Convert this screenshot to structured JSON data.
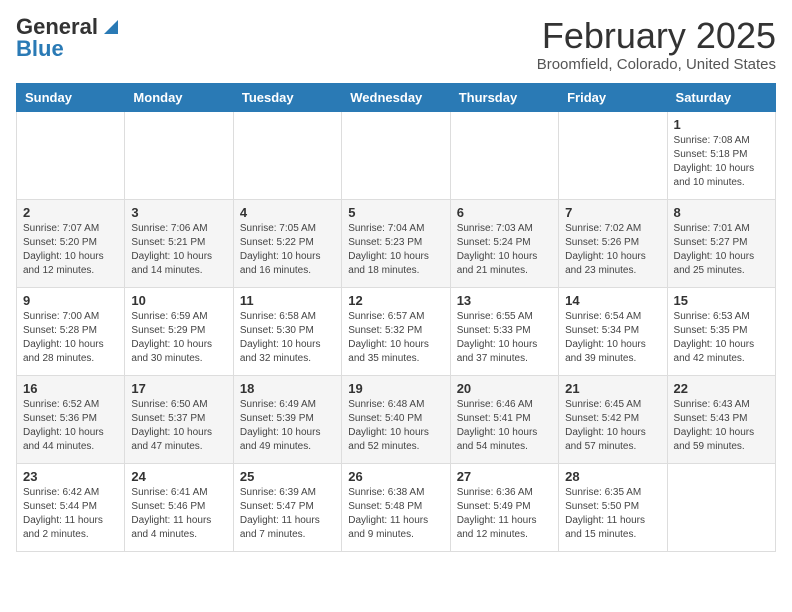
{
  "header": {
    "logo_general": "General",
    "logo_blue": "Blue",
    "main_title": "February 2025",
    "subtitle": "Broomfield, Colorado, United States"
  },
  "calendar": {
    "days_of_week": [
      "Sunday",
      "Monday",
      "Tuesday",
      "Wednesday",
      "Thursday",
      "Friday",
      "Saturday"
    ],
    "weeks": [
      [
        {
          "day": "",
          "info": ""
        },
        {
          "day": "",
          "info": ""
        },
        {
          "day": "",
          "info": ""
        },
        {
          "day": "",
          "info": ""
        },
        {
          "day": "",
          "info": ""
        },
        {
          "day": "",
          "info": ""
        },
        {
          "day": "1",
          "info": "Sunrise: 7:08 AM\nSunset: 5:18 PM\nDaylight: 10 hours\nand 10 minutes."
        }
      ],
      [
        {
          "day": "2",
          "info": "Sunrise: 7:07 AM\nSunset: 5:20 PM\nDaylight: 10 hours\nand 12 minutes."
        },
        {
          "day": "3",
          "info": "Sunrise: 7:06 AM\nSunset: 5:21 PM\nDaylight: 10 hours\nand 14 minutes."
        },
        {
          "day": "4",
          "info": "Sunrise: 7:05 AM\nSunset: 5:22 PM\nDaylight: 10 hours\nand 16 minutes."
        },
        {
          "day": "5",
          "info": "Sunrise: 7:04 AM\nSunset: 5:23 PM\nDaylight: 10 hours\nand 18 minutes."
        },
        {
          "day": "6",
          "info": "Sunrise: 7:03 AM\nSunset: 5:24 PM\nDaylight: 10 hours\nand 21 minutes."
        },
        {
          "day": "7",
          "info": "Sunrise: 7:02 AM\nSunset: 5:26 PM\nDaylight: 10 hours\nand 23 minutes."
        },
        {
          "day": "8",
          "info": "Sunrise: 7:01 AM\nSunset: 5:27 PM\nDaylight: 10 hours\nand 25 minutes."
        }
      ],
      [
        {
          "day": "9",
          "info": "Sunrise: 7:00 AM\nSunset: 5:28 PM\nDaylight: 10 hours\nand 28 minutes."
        },
        {
          "day": "10",
          "info": "Sunrise: 6:59 AM\nSunset: 5:29 PM\nDaylight: 10 hours\nand 30 minutes."
        },
        {
          "day": "11",
          "info": "Sunrise: 6:58 AM\nSunset: 5:30 PM\nDaylight: 10 hours\nand 32 minutes."
        },
        {
          "day": "12",
          "info": "Sunrise: 6:57 AM\nSunset: 5:32 PM\nDaylight: 10 hours\nand 35 minutes."
        },
        {
          "day": "13",
          "info": "Sunrise: 6:55 AM\nSunset: 5:33 PM\nDaylight: 10 hours\nand 37 minutes."
        },
        {
          "day": "14",
          "info": "Sunrise: 6:54 AM\nSunset: 5:34 PM\nDaylight: 10 hours\nand 39 minutes."
        },
        {
          "day": "15",
          "info": "Sunrise: 6:53 AM\nSunset: 5:35 PM\nDaylight: 10 hours\nand 42 minutes."
        }
      ],
      [
        {
          "day": "16",
          "info": "Sunrise: 6:52 AM\nSunset: 5:36 PM\nDaylight: 10 hours\nand 44 minutes."
        },
        {
          "day": "17",
          "info": "Sunrise: 6:50 AM\nSunset: 5:37 PM\nDaylight: 10 hours\nand 47 minutes."
        },
        {
          "day": "18",
          "info": "Sunrise: 6:49 AM\nSunset: 5:39 PM\nDaylight: 10 hours\nand 49 minutes."
        },
        {
          "day": "19",
          "info": "Sunrise: 6:48 AM\nSunset: 5:40 PM\nDaylight: 10 hours\nand 52 minutes."
        },
        {
          "day": "20",
          "info": "Sunrise: 6:46 AM\nSunset: 5:41 PM\nDaylight: 10 hours\nand 54 minutes."
        },
        {
          "day": "21",
          "info": "Sunrise: 6:45 AM\nSunset: 5:42 PM\nDaylight: 10 hours\nand 57 minutes."
        },
        {
          "day": "22",
          "info": "Sunrise: 6:43 AM\nSunset: 5:43 PM\nDaylight: 10 hours\nand 59 minutes."
        }
      ],
      [
        {
          "day": "23",
          "info": "Sunrise: 6:42 AM\nSunset: 5:44 PM\nDaylight: 11 hours\nand 2 minutes."
        },
        {
          "day": "24",
          "info": "Sunrise: 6:41 AM\nSunset: 5:46 PM\nDaylight: 11 hours\nand 4 minutes."
        },
        {
          "day": "25",
          "info": "Sunrise: 6:39 AM\nSunset: 5:47 PM\nDaylight: 11 hours\nand 7 minutes."
        },
        {
          "day": "26",
          "info": "Sunrise: 6:38 AM\nSunset: 5:48 PM\nDaylight: 11 hours\nand 9 minutes."
        },
        {
          "day": "27",
          "info": "Sunrise: 6:36 AM\nSunset: 5:49 PM\nDaylight: 11 hours\nand 12 minutes."
        },
        {
          "day": "28",
          "info": "Sunrise: 6:35 AM\nSunset: 5:50 PM\nDaylight: 11 hours\nand 15 minutes."
        },
        {
          "day": "",
          "info": ""
        }
      ]
    ]
  }
}
